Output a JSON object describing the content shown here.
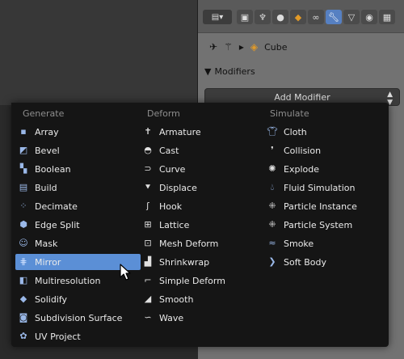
{
  "properties": {
    "breadcrumb_object": "Cube",
    "panel_title": "Modifiers",
    "add_modifier_label": "Add Modifier"
  },
  "menu": {
    "columns": [
      {
        "header": "Generate",
        "items": [
          {
            "label": "Array",
            "icon": "array-icon"
          },
          {
            "label": "Bevel",
            "icon": "bevel-icon"
          },
          {
            "label": "Boolean",
            "icon": "boolean-icon"
          },
          {
            "label": "Build",
            "icon": "build-icon"
          },
          {
            "label": "Decimate",
            "icon": "decimate-icon"
          },
          {
            "label": "Edge Split",
            "icon": "edge-split-icon"
          },
          {
            "label": "Mask",
            "icon": "mask-icon"
          },
          {
            "label": "Mirror",
            "icon": "mirror-icon",
            "highlighted": true
          },
          {
            "label": "Multiresolution",
            "icon": "multiresolution-icon"
          },
          {
            "label": "Solidify",
            "icon": "solidify-icon"
          },
          {
            "label": "Subdivision Surface",
            "icon": "subdivision-surface-icon"
          },
          {
            "label": "UV Project",
            "icon": "uv-project-icon"
          }
        ]
      },
      {
        "header": "Deform",
        "items": [
          {
            "label": "Armature",
            "icon": "armature-icon"
          },
          {
            "label": "Cast",
            "icon": "cast-icon"
          },
          {
            "label": "Curve",
            "icon": "curve-icon"
          },
          {
            "label": "Displace",
            "icon": "displace-icon"
          },
          {
            "label": "Hook",
            "icon": "hook-icon"
          },
          {
            "label": "Lattice",
            "icon": "lattice-icon"
          },
          {
            "label": "Mesh Deform",
            "icon": "mesh-deform-icon"
          },
          {
            "label": "Shrinkwrap",
            "icon": "shrinkwrap-icon"
          },
          {
            "label": "Simple Deform",
            "icon": "simple-deform-icon"
          },
          {
            "label": "Smooth",
            "icon": "smooth-icon"
          },
          {
            "label": "Wave",
            "icon": "wave-icon"
          }
        ]
      },
      {
        "header": "Simulate",
        "items": [
          {
            "label": "Cloth",
            "icon": "cloth-icon"
          },
          {
            "label": "Collision",
            "icon": "collision-icon"
          },
          {
            "label": "Explode",
            "icon": "explode-icon"
          },
          {
            "label": "Fluid Simulation",
            "icon": "fluid-simulation-icon"
          },
          {
            "label": "Particle Instance",
            "icon": "particle-instance-icon"
          },
          {
            "label": "Particle System",
            "icon": "particle-system-icon"
          },
          {
            "label": "Smoke",
            "icon": "smoke-icon"
          },
          {
            "label": "Soft Body",
            "icon": "soft-body-icon"
          }
        ]
      }
    ]
  },
  "colors": {
    "menu_background": "#151515",
    "highlight": "#5b8fd6",
    "header_text": "#8e8e8e",
    "item_text": "#eaeaea",
    "active_tab": "#5680c2"
  }
}
